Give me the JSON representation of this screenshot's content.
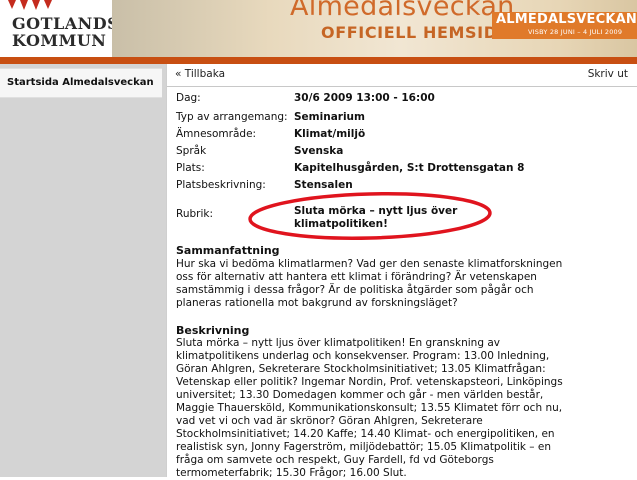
{
  "header": {
    "logo_line1": "GOTLANDS",
    "logo_line2": "KOMMUN",
    "title": "Almedalsveckan",
    "subtitle": "OFFICIELL HEMSIDA",
    "badge_title": "ALMEDALSVECKAN",
    "badge_dates": "VISBY 28 JUNI – 4 JULI 2009",
    "accent_color": "#c84f12"
  },
  "sidebar": {
    "items": [
      {
        "label": "Startsida Almedalsveckan"
      }
    ]
  },
  "toolbar": {
    "back_label": "« Tillbaka",
    "print_label": "Skriv ut"
  },
  "event": {
    "fields": [
      {
        "label": "Dag:",
        "value": "30/6 2009 13:00 - 16:00"
      },
      {
        "label": "Typ av arrangemang:",
        "value": "Seminarium"
      },
      {
        "label": "Ämnesområde:",
        "value": "Klimat/miljö"
      },
      {
        "label": "Språk",
        "value": "Svenska"
      },
      {
        "label": "Plats:",
        "value": "Kapitelhusgården, S:t Drottensgatan 8"
      },
      {
        "label": "Platsbeskrivning:",
        "value": "Stensalen"
      }
    ],
    "rubrik_label": "Rubrik:",
    "rubrik_lines": [
      "Sluta mörka – nytt ljus över",
      "klimatpolitiken!"
    ],
    "annotation_color": "#e0141e"
  },
  "summary": {
    "heading": "Sammanfattning",
    "lines": [
      "Hur ska vi bedöma klimatlarmen? Vad ger den senaste klimatforskningen",
      "oss för alternativ att hantera ett klimat i förändring? Är vetenskapen",
      "samstämmig i dessa frågor? Är de politiska åtgärder som pågår och",
      "planeras rationella mot bakgrund av forskningsläget?"
    ]
  },
  "description": {
    "heading": "Beskrivning",
    "lines": [
      "Sluta mörka – nytt ljus över klimatpolitiken! En granskning av",
      "klimatpolitikens underlag och konsekvenser. Program: 13.00 Inledning,",
      "Göran Ahlgren, Sekreterare Stockholmsinitiativet; 13.05 Klimatfrågan:",
      "Vetenskap eller politik? Ingemar Nordin, Prof. vetenskapsteori, Linköpings",
      "universitet; 13.30 Domedagen kommer och går - men världen består,",
      "Maggie Thauersköld, Kommunikationskonsult; 13.55 Klimatet förr och nu,",
      "vad vet vi och vad är skrönor? Göran Ahlgren, Sekreterare",
      "Stockholmsinitiativet; 14.20 Kaffe; 14.40 Klimat- och energipolitiken, en",
      "realistisk syn, Jonny Fagerström, miljödebattör; 15.05 Klimatpolitik – en",
      "fråga om samvete och respekt, Guy Fardell, fd vd Göteborgs",
      "termometerfabrik; 15.30 Frågor; 16.00 Slut."
    ]
  }
}
